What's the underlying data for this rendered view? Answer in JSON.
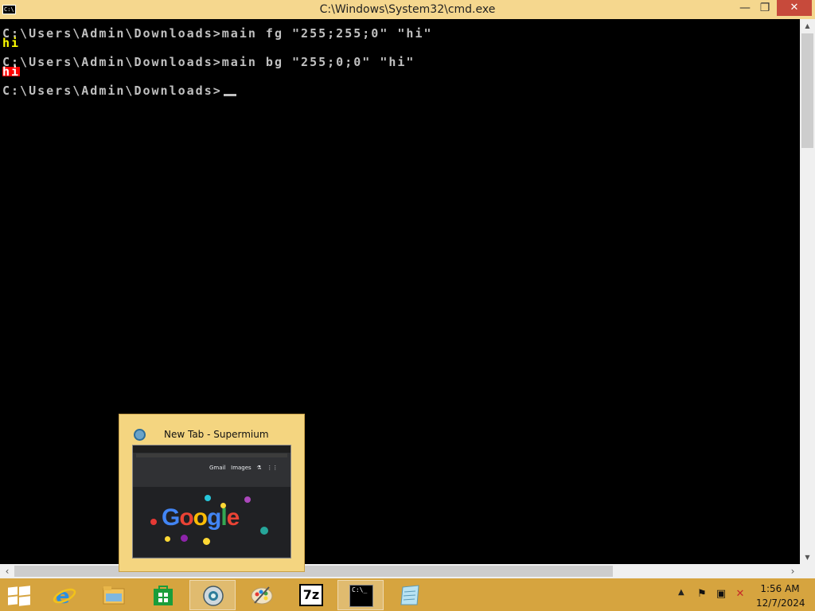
{
  "window": {
    "title": "C:\\Windows\\System32\\cmd.exe",
    "icon_label": "C:\\",
    "minimize_glyph": "—",
    "maximize_glyph": "❐",
    "close_glyph": "✕"
  },
  "console": {
    "lines": [
      "C:\\Users\\Admin\\Downloads>main fg \"255;255;0\" \"hi\"",
      "hi",
      "C:\\Users\\Admin\\Downloads>main bg \"255;0;0\" \"hi\"",
      "hi",
      "C:\\Users\\Admin\\Downloads>"
    ],
    "colors": {
      "default_fg": "#c0c0c0",
      "yellow_output": "#ffff00",
      "red_background": "#ff0000"
    }
  },
  "taskbar": {
    "items": [
      {
        "name": "start-button",
        "icon": "windows-logo-icon"
      },
      {
        "name": "internet-explorer",
        "icon": "internet-explorer-icon"
      },
      {
        "name": "file-explorer",
        "icon": "folder-icon"
      },
      {
        "name": "store",
        "icon": "store-icon"
      },
      {
        "name": "supermium",
        "icon": "supermium-icon",
        "active": true
      },
      {
        "name": "paint",
        "icon": "palette-icon"
      },
      {
        "name": "7-zip",
        "icon": "7zip-icon",
        "label": "7z"
      },
      {
        "name": "command-prompt",
        "icon": "cmd-icon",
        "label": "C:\\_"
      },
      {
        "name": "notepad",
        "icon": "notepad-icon"
      }
    ],
    "tray": {
      "time": "1:56 AM",
      "date": "12/7/2024"
    },
    "color": "#d6a43f"
  },
  "preview": {
    "title": "New Tab - Supermium",
    "thumbnail": {
      "links": [
        "Gmail",
        "Images"
      ],
      "logo": "Google"
    }
  }
}
